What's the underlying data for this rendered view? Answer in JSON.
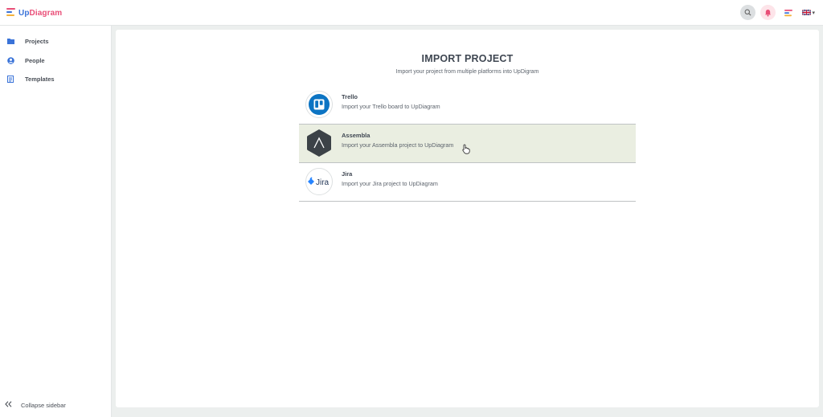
{
  "app": {
    "logo_up": "Up",
    "logo_diagram": "Diagram"
  },
  "colors": {
    "accent_pink": "#e94e77",
    "accent_blue": "#3a73d8",
    "hover_row": "#eaeee1",
    "trello_blue": "#0c74c3",
    "assembla_dark": "#3c4247",
    "jira_blue": "#2684ff"
  },
  "topbar": {
    "icons": [
      "search-icon",
      "bell-icon",
      "app-logo-icon",
      "uk-flag-icon"
    ]
  },
  "sidebar": {
    "items": [
      {
        "label": "Projects",
        "icon": "folder-icon"
      },
      {
        "label": "People",
        "icon": "user-icon"
      },
      {
        "label": "Templates",
        "icon": "template-icon"
      }
    ],
    "collapse_label": "Collapse sidebar"
  },
  "main": {
    "title": "IMPORT PROJECT",
    "subtitle": "Import your project from multiple platforms into UpDigram",
    "sources": [
      {
        "name": "Trello",
        "description": "Import your Trello board to UpDiagram",
        "icon": "trello-logo"
      },
      {
        "name": "Assembla",
        "description": "Import your Assembla project to UpDiagram",
        "icon": "assembla-logo",
        "hovered": true
      },
      {
        "name": "Jira",
        "description": "Import your Jira project to UpDiagram",
        "icon": "jira-logo",
        "logo_text": "Jira"
      }
    ]
  }
}
